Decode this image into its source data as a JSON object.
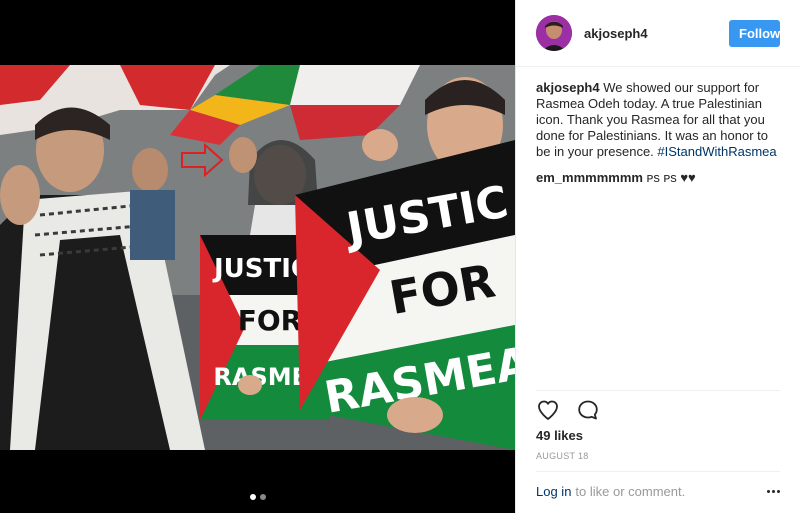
{
  "post": {
    "username": "akjoseph4",
    "follow_label": "Follow",
    "caption_username": "akjoseph4",
    "caption_text": " We showed our support for Rasmea Odeh today. A true Palestinian icon. Thank you Rasmea for all that you done for Palestinians. It was an honor to be in your presence. ",
    "caption_hashtag": "#IStandWithRasmea",
    "comments": [
      {
        "username": "em_mmmmmmm",
        "text": " ᴘs ᴘs ♥♥"
      }
    ],
    "likes": "49 likes",
    "date": "August 18",
    "login_link": "Log in",
    "login_suffix": "to like or comment."
  },
  "photo": {
    "signs": [
      {
        "line1": "JUSTIC",
        "line2": "FOR",
        "line3": "RASMEA"
      },
      {
        "line1": "JUSTIC",
        "line2": "FOR",
        "line3": "RASMEA"
      }
    ]
  },
  "carousel": {
    "count": 2,
    "active_index": 0
  },
  "icons": {
    "like": "heart-icon",
    "comment": "comment-icon",
    "more": "more-options-icon"
  },
  "colors": {
    "follow": "#3897f0",
    "hashtag": "#003569",
    "flag_red": "#d8262c",
    "flag_green": "#138a3c"
  }
}
